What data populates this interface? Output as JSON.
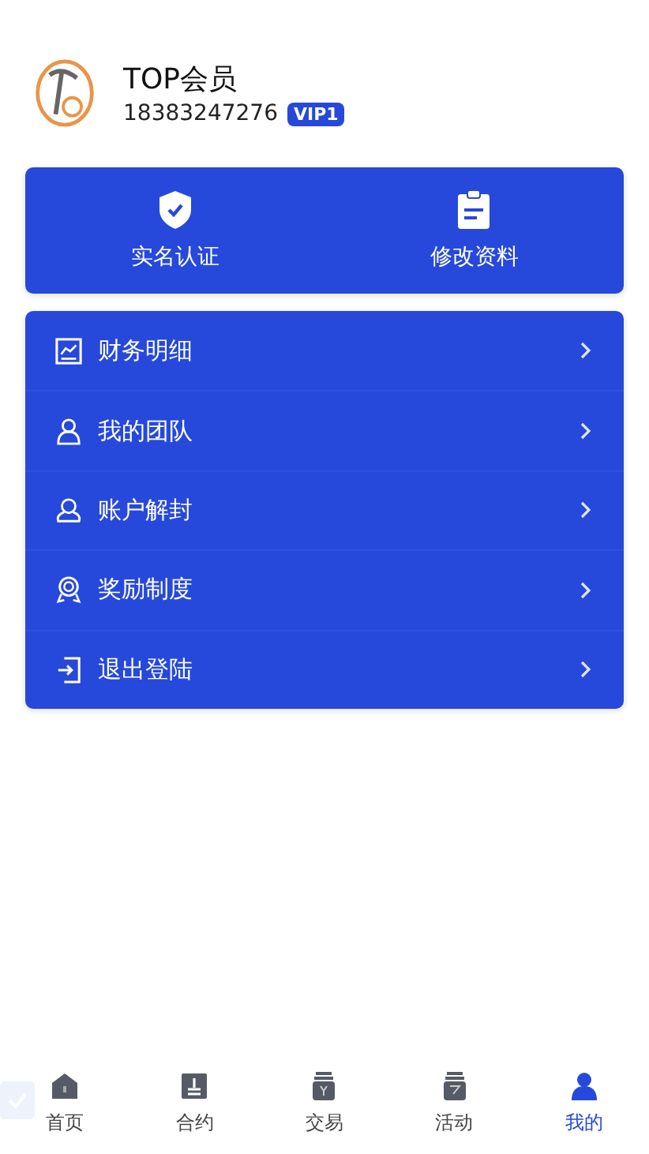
{
  "profile": {
    "name": "TOP会员",
    "phone": "18383247276",
    "badge": "VIP1"
  },
  "actions": [
    {
      "label": "实名认证",
      "kind": "shield"
    },
    {
      "label": "修改资料",
      "kind": "clipboard"
    }
  ],
  "menu": [
    {
      "label": "财务明细",
      "kind": "chart"
    },
    {
      "label": "我的团队",
      "kind": "team"
    },
    {
      "label": "账户解封",
      "kind": "user"
    },
    {
      "label": "奖励制度",
      "kind": "award"
    },
    {
      "label": "退出登陆",
      "kind": "logout"
    }
  ],
  "tabs": [
    {
      "label": "首页",
      "kind": "home",
      "selected": false
    },
    {
      "label": "合约",
      "kind": "stamp",
      "selected": false
    },
    {
      "label": "交易",
      "kind": "jar",
      "selected": false
    },
    {
      "label": "活动",
      "kind": "bucket",
      "selected": false
    },
    {
      "label": "我的",
      "kind": "person",
      "selected": true
    }
  ]
}
